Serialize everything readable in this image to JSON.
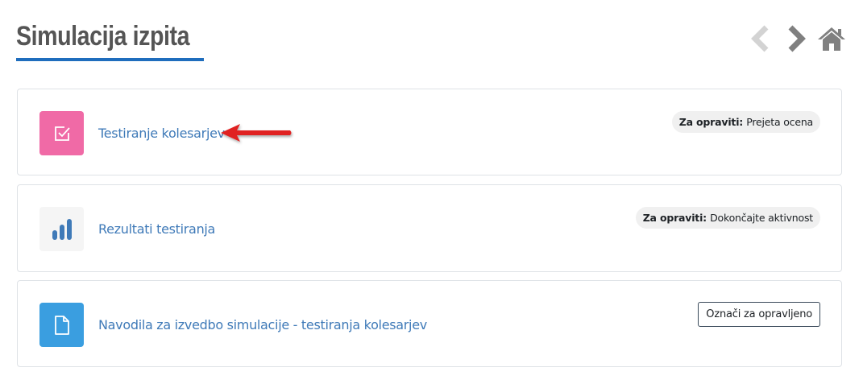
{
  "header": {
    "title": "Simulacija izpita"
  },
  "nav": {
    "prev_icon": "chevron-left-icon",
    "next_icon": "chevron-right-icon",
    "home_icon": "home-icon"
  },
  "activities": [
    {
      "name": "Testiranje kolesarjev",
      "icon": "quiz-checkbox-icon",
      "icon_color": "#f06aa6",
      "completion_label": "Za opraviti:",
      "completion_value": "Prejeta ocena"
    },
    {
      "name": "Rezultati testiranja",
      "icon": "bar-chart-icon",
      "icon_color": "#3f7ab8",
      "completion_label": "Za opraviti:",
      "completion_value": "Dokončajte aktivnost"
    },
    {
      "name": "Navodila za izvedbo simulacije - testiranja kolesarjev",
      "icon": "document-icon",
      "icon_color": "#3a9ee0",
      "button_label": "Označi za opravljeno"
    }
  ],
  "colors": {
    "title_underline": "#1f6dbd",
    "link": "#3f7ab8",
    "arrow": "#e02020"
  }
}
